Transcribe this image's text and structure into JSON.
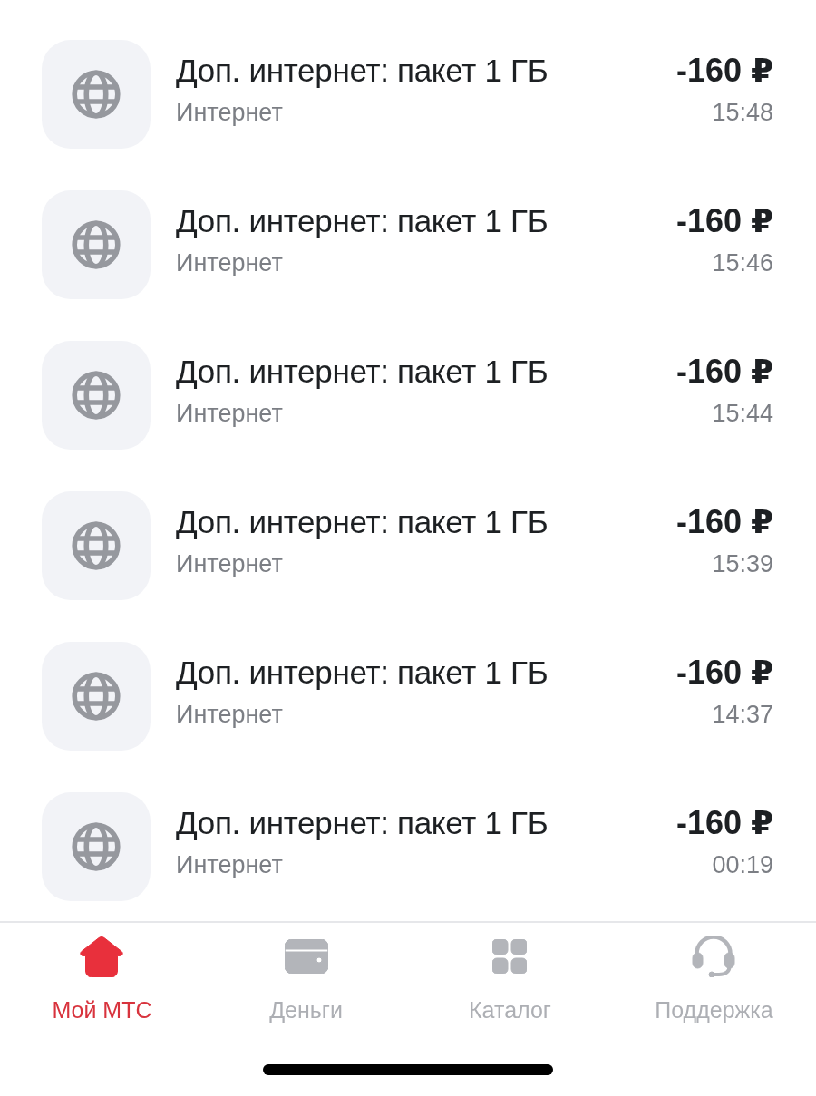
{
  "transactions": [
    {
      "title": "Доп. интернет: пакет 1 ГБ",
      "category": "Интернет",
      "amount": "-160 ₽",
      "time": "15:48"
    },
    {
      "title": "Доп. интернет: пакет 1 ГБ",
      "category": "Интернет",
      "amount": "-160 ₽",
      "time": "15:46"
    },
    {
      "title": "Доп. интернет: пакет 1 ГБ",
      "category": "Интернет",
      "amount": "-160 ₽",
      "time": "15:44"
    },
    {
      "title": "Доп. интернет: пакет 1 ГБ",
      "category": "Интернет",
      "amount": "-160 ₽",
      "time": "15:39"
    },
    {
      "title": "Доп. интернет: пакет 1 ГБ",
      "category": "Интернет",
      "amount": "-160 ₽",
      "time": "14:37"
    },
    {
      "title": "Доп. интернет: пакет 1 ГБ",
      "category": "Интернет",
      "amount": "-160 ₽",
      "time": "00:19"
    }
  ],
  "tab_bar": {
    "tabs": [
      {
        "label": "Мой МТС",
        "selected": true,
        "kind": "home"
      },
      {
        "label": "Деньги",
        "selected": false,
        "kind": "wallet"
      },
      {
        "label": "Каталог",
        "selected": false,
        "kind": "catalog"
      },
      {
        "label": "Поддержка",
        "selected": false,
        "kind": "support"
      }
    ]
  }
}
